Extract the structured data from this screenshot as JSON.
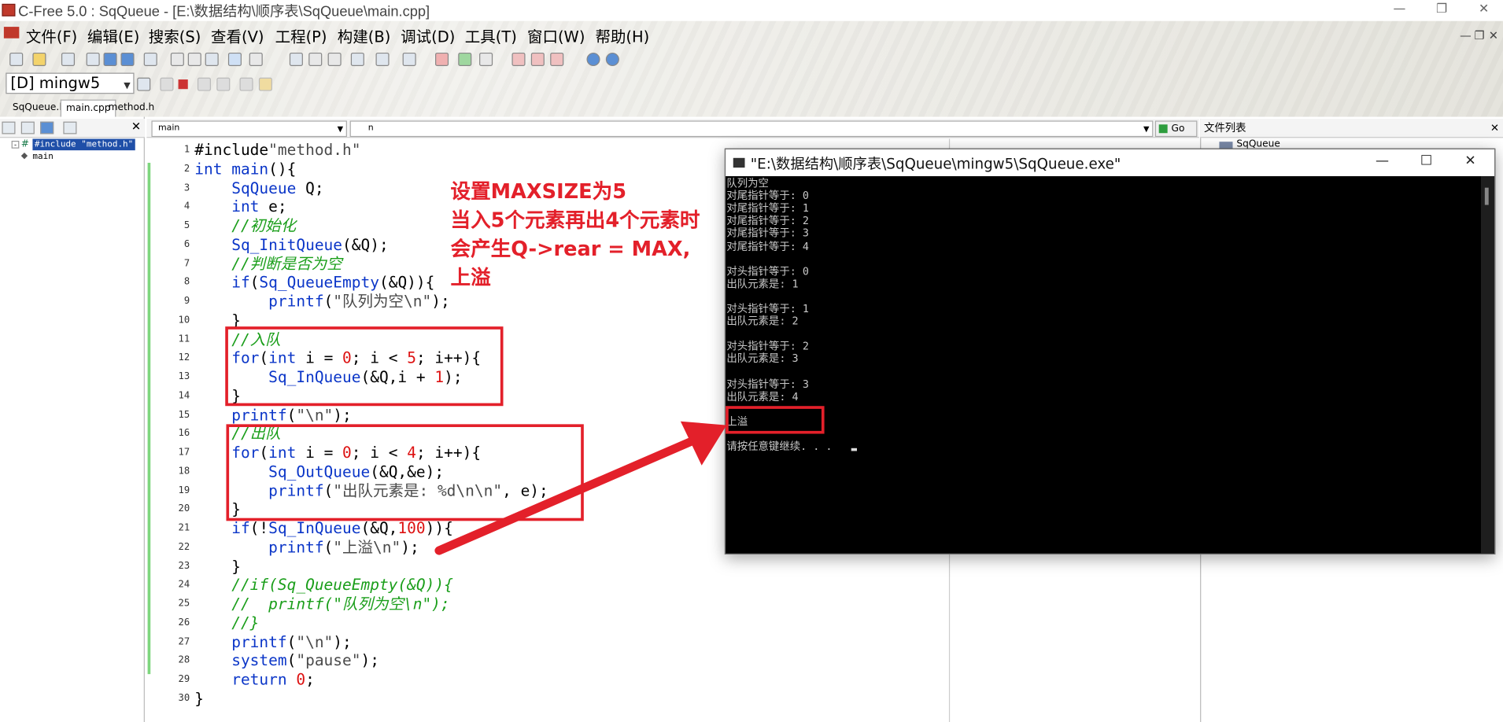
{
  "window": {
    "title": "C-Free 5.0 : SqQueue - [E:\\数据结构\\顺序表\\SqQueue\\main.cpp]"
  },
  "menu": [
    "文件(F)",
    "编辑(E)",
    "搜索(S)",
    "查看(V)",
    "工程(P)",
    "构建(B)",
    "调试(D)",
    "工具(T)",
    "窗口(W)",
    "帮助(H)"
  ],
  "toolbar": {
    "compiler": "[D] mingw5"
  },
  "tabs": [
    "SqQueue.h",
    "main.cpp",
    "method.h"
  ],
  "left_panel": {
    "items": [
      "#include \"method.h\"",
      "main"
    ]
  },
  "editor_bar": {
    "function_combo": "main",
    "symbol_combo": "n",
    "go_label": "Go"
  },
  "right_panel": {
    "title": "文件列表",
    "item": "SqQueue"
  },
  "code_lines": [
    {
      "n": "1",
      "text": "#include\"method.h\""
    },
    {
      "n": "2",
      "text": "int main(){"
    },
    {
      "n": "3",
      "text": "    SqQueue Q;"
    },
    {
      "n": "4",
      "text": "    int e;"
    },
    {
      "n": "5",
      "text": "    //初始化"
    },
    {
      "n": "6",
      "text": "    Sq_InitQueue(&Q);"
    },
    {
      "n": "7",
      "text": "    //判断是否为空"
    },
    {
      "n": "8",
      "text": "    if(Sq_QueueEmpty(&Q)){"
    },
    {
      "n": "9",
      "text": "        printf(\"队列为空\\n\");"
    },
    {
      "n": "10",
      "text": "    }"
    },
    {
      "n": "11",
      "text": "    //入队"
    },
    {
      "n": "12",
      "text": "    for(int i = 0; i < 5; i++){"
    },
    {
      "n": "13",
      "text": "        Sq_InQueue(&Q,i + 1);"
    },
    {
      "n": "14",
      "text": "    }"
    },
    {
      "n": "15",
      "text": "    printf(\"\\n\");"
    },
    {
      "n": "16",
      "text": "    //出队"
    },
    {
      "n": "17",
      "text": "    for(int i = 0; i < 4; i++){"
    },
    {
      "n": "18",
      "text": "        Sq_OutQueue(&Q,&e);"
    },
    {
      "n": "19",
      "text": "        printf(\"出队元素是: %d\\n\\n\", e);"
    },
    {
      "n": "20",
      "text": "    }"
    },
    {
      "n": "21",
      "text": "    if(!Sq_InQueue(&Q,100)){"
    },
    {
      "n": "22",
      "text": "        printf(\"上溢\\n\");"
    },
    {
      "n": "23",
      "text": "    }"
    },
    {
      "n": "24",
      "text": "    //if(Sq_QueueEmpty(&Q)){"
    },
    {
      "n": "25",
      "text": "    //  printf(\"队列为空\\n\");"
    },
    {
      "n": "26",
      "text": "    //}"
    },
    {
      "n": "27",
      "text": "    printf(\"\\n\");"
    },
    {
      "n": "28",
      "text": "    system(\"pause\");"
    },
    {
      "n": "29",
      "text": "    return 0;"
    },
    {
      "n": "30",
      "text": "}"
    }
  ],
  "console": {
    "title": "\"E:\\数据结构\\顺序表\\SqQueue\\mingw5\\SqQueue.exe\"",
    "lines": [
      "队列为空",
      "对尾指针等于: 0",
      "对尾指针等于: 1",
      "对尾指针等于: 2",
      "对尾指针等于: 3",
      "对尾指针等于: 4",
      "",
      "对头指针等于: 0",
      "出队元素是: 1",
      "",
      "对头指针等于: 1",
      "出队元素是: 2",
      "",
      "对头指针等于: 2",
      "出队元素是: 3",
      "",
      "对头指针等于: 3",
      "出队元素是: 4",
      "",
      "上溢",
      "",
      "请按任意键继续. . ."
    ]
  },
  "annotation": {
    "lines": [
      "设置MAXSIZE为5",
      "当入5个元素再出4个元素时",
      "会产生Q->rear = MAX,",
      "上溢"
    ],
    "color": "#e3202a"
  }
}
